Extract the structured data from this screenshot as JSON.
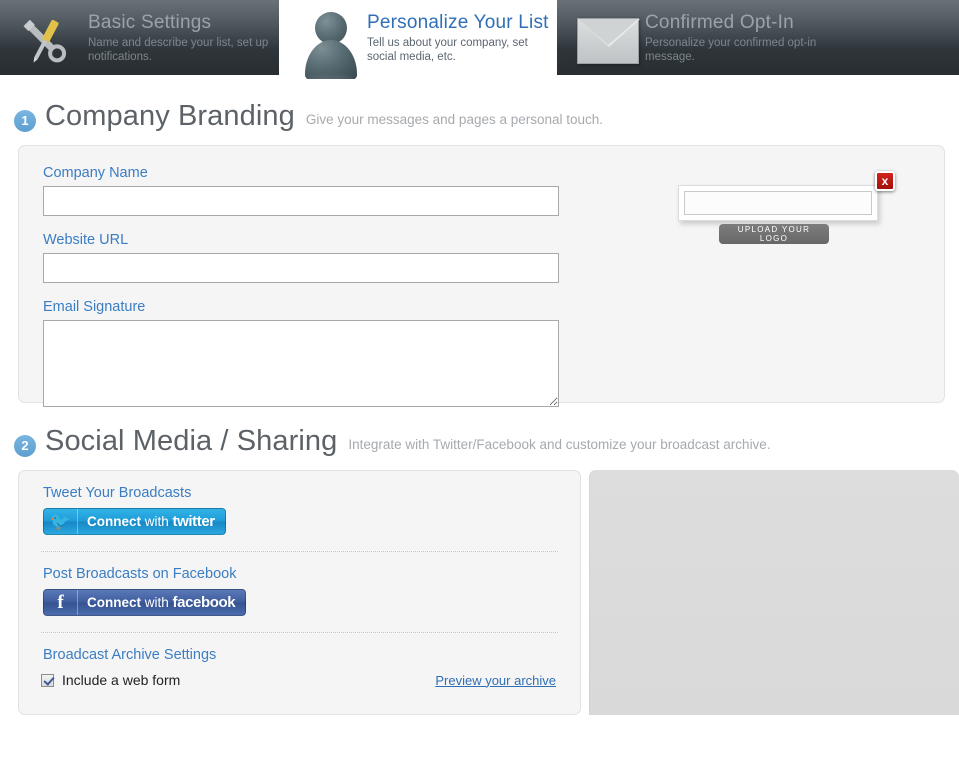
{
  "tabs": [
    {
      "id": "basic-settings",
      "title": "Basic Settings",
      "subtitle": "Name and describe your list, set up notifications.",
      "icon": "tools-icon",
      "active": false
    },
    {
      "id": "personalize-your-list",
      "title": "Personalize Your List",
      "subtitle": "Tell us about your company, set social media, etc.",
      "icon": "person-icon",
      "active": true
    },
    {
      "id": "confirmed-opt-in",
      "title": "Confirmed Opt-In",
      "subtitle": "Personalize your confirmed opt-in message.",
      "icon": "envelope-icon",
      "active": false
    }
  ],
  "sections": {
    "branding": {
      "number": "1",
      "title": "Company Branding",
      "subtitle": "Give your messages and pages a personal touch.",
      "fields": {
        "company_name": {
          "label": "Company Name",
          "value": "",
          "placeholder": ""
        },
        "website_url": {
          "label": "Website URL",
          "value": "",
          "placeholder": ""
        },
        "email_signature": {
          "label": "Email Signature",
          "value": "",
          "placeholder": ""
        }
      },
      "logo": {
        "filename": "",
        "remove_label": "x",
        "upload_label": "Upload your logo"
      }
    },
    "social": {
      "number": "2",
      "title": "Social Media / Sharing",
      "subtitle": "Integrate with Twitter/Facebook and customize your broadcast archive.",
      "twitter": {
        "label": "Tweet Your Broadcasts",
        "button_prefix": "Connect",
        "button_with": "with",
        "button_brand": "twitter"
      },
      "facebook": {
        "label": "Post Broadcasts on Facebook",
        "button_prefix": "Connect",
        "button_with": "with",
        "button_brand": "facebook"
      },
      "archive": {
        "label": "Broadcast Archive Settings",
        "checkbox_label": "Include a web form",
        "checkbox_checked": true,
        "preview_link": "Preview your archive"
      }
    }
  },
  "colors": {
    "accent_blue": "#3a7dc4",
    "badge_blue": "#5d9fd0",
    "twitter_blue": "#1e9ad6",
    "facebook_blue": "#3e5c9d",
    "remove_red": "#c0201a",
    "panel_bg": "#f5f5f5"
  }
}
